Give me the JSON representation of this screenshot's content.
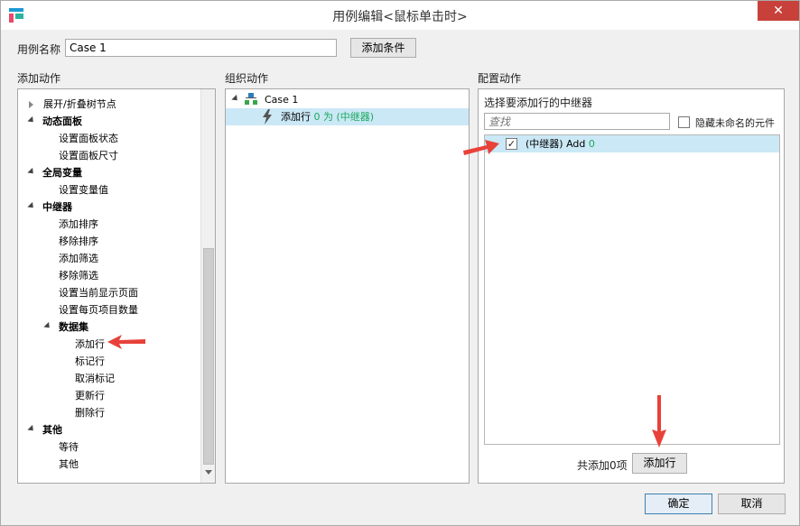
{
  "window": {
    "title": "用例编辑<鼠标单击时>",
    "close_symbol": "✕"
  },
  "case_name": {
    "label": "用例名称",
    "value": "Case 1",
    "add_condition_label": "添加条件"
  },
  "add_actions": {
    "header": "添加动作",
    "items": [
      {
        "label": "展开/折叠树节点",
        "bold": false,
        "expander": "right"
      },
      {
        "label": "动态面板",
        "bold": true,
        "expander": "down"
      },
      {
        "label": "设置面板状态",
        "bold": false,
        "expander": ""
      },
      {
        "label": "设置面板尺寸",
        "bold": false,
        "expander": ""
      },
      {
        "label": "全局变量",
        "bold": true,
        "expander": "down"
      },
      {
        "label": "设置变量值",
        "bold": false,
        "expander": ""
      },
      {
        "label": "中继器",
        "bold": true,
        "expander": "down"
      },
      {
        "label": "添加排序",
        "bold": false,
        "expander": ""
      },
      {
        "label": "移除排序",
        "bold": false,
        "expander": ""
      },
      {
        "label": "添加筛选",
        "bold": false,
        "expander": ""
      },
      {
        "label": "移除筛选",
        "bold": false,
        "expander": ""
      },
      {
        "label": "设置当前显示页面",
        "bold": false,
        "expander": ""
      },
      {
        "label": "设置每页项目数量",
        "bold": false,
        "expander": ""
      },
      {
        "label": "数据集",
        "bold": true,
        "expander": "down"
      },
      {
        "label": "添加行",
        "bold": false,
        "expander": ""
      },
      {
        "label": "标记行",
        "bold": false,
        "expander": ""
      },
      {
        "label": "取消标记",
        "bold": false,
        "expander": ""
      },
      {
        "label": "更新行",
        "bold": false,
        "expander": ""
      },
      {
        "label": "删除行",
        "bold": false,
        "expander": ""
      },
      {
        "label": "其他",
        "bold": true,
        "expander": "down"
      },
      {
        "label": "等待",
        "bold": false,
        "expander": ""
      },
      {
        "label": "其他",
        "bold": false,
        "expander": ""
      }
    ]
  },
  "organize_actions": {
    "header": "组织动作",
    "case_label": "Case 1",
    "action_prefix": "添加行",
    "action_detail": "0 为 (中继器)"
  },
  "configure_actions": {
    "header": "配置动作",
    "subheader": "选择要添加行的中继器",
    "search_placeholder": "查找",
    "hide_unnamed_label": "隐藏未命名的元件",
    "repeater_item_label": "(中继器) Add",
    "repeater_item_count": "0",
    "repeater_item_checked": true,
    "total_added_label": "共添加0项",
    "add_row_button": "添加行"
  },
  "footer": {
    "ok_label": "确定",
    "cancel_label": "取消"
  },
  "colors": {
    "annotation_arrow": "#e8413a",
    "selection": "#cbe8f6",
    "green_text": "#1aa85b"
  }
}
